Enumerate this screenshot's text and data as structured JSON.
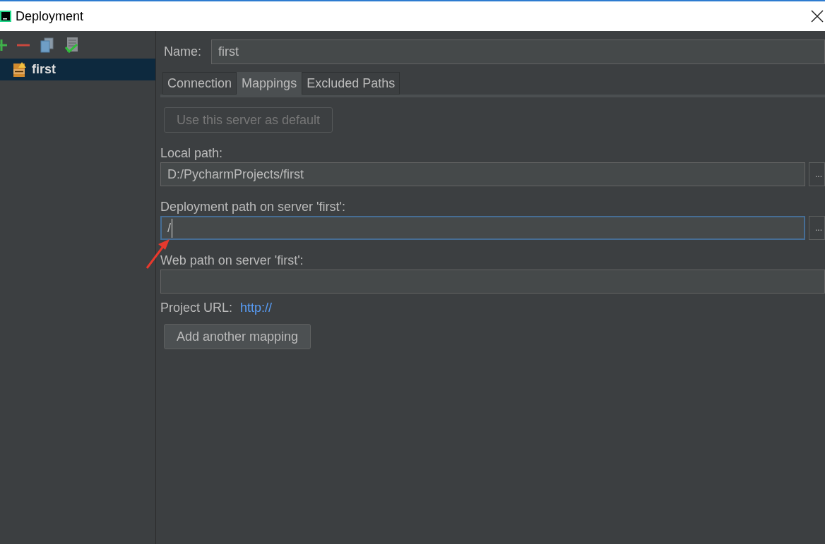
{
  "window": {
    "title": "Deployment"
  },
  "servers": [
    {
      "label": "first",
      "selected": true
    }
  ],
  "name_field": {
    "label": "Name:",
    "value": "first"
  },
  "tabs": [
    {
      "label": "Connection",
      "selected": false
    },
    {
      "label": "Mappings",
      "selected": true
    },
    {
      "label": "Excluded Paths",
      "selected": false
    }
  ],
  "default_button": {
    "label": "Use this server as default",
    "disabled": true
  },
  "fields": [
    {
      "label": "Local path:",
      "value": "D:/PycharmProjects/first",
      "focused": false,
      "browse": "...",
      "cursor": false
    },
    {
      "label": "Deployment path on server 'first':",
      "value": "/",
      "focused": true,
      "browse": "...",
      "cursor": true
    },
    {
      "label": "Web path on server 'first':",
      "focused": false,
      "cursor": false
    }
  ],
  "project_url": {
    "label": "Project URL:",
    "link": "http://"
  },
  "add_button": {
    "label": "Add another mapping"
  }
}
